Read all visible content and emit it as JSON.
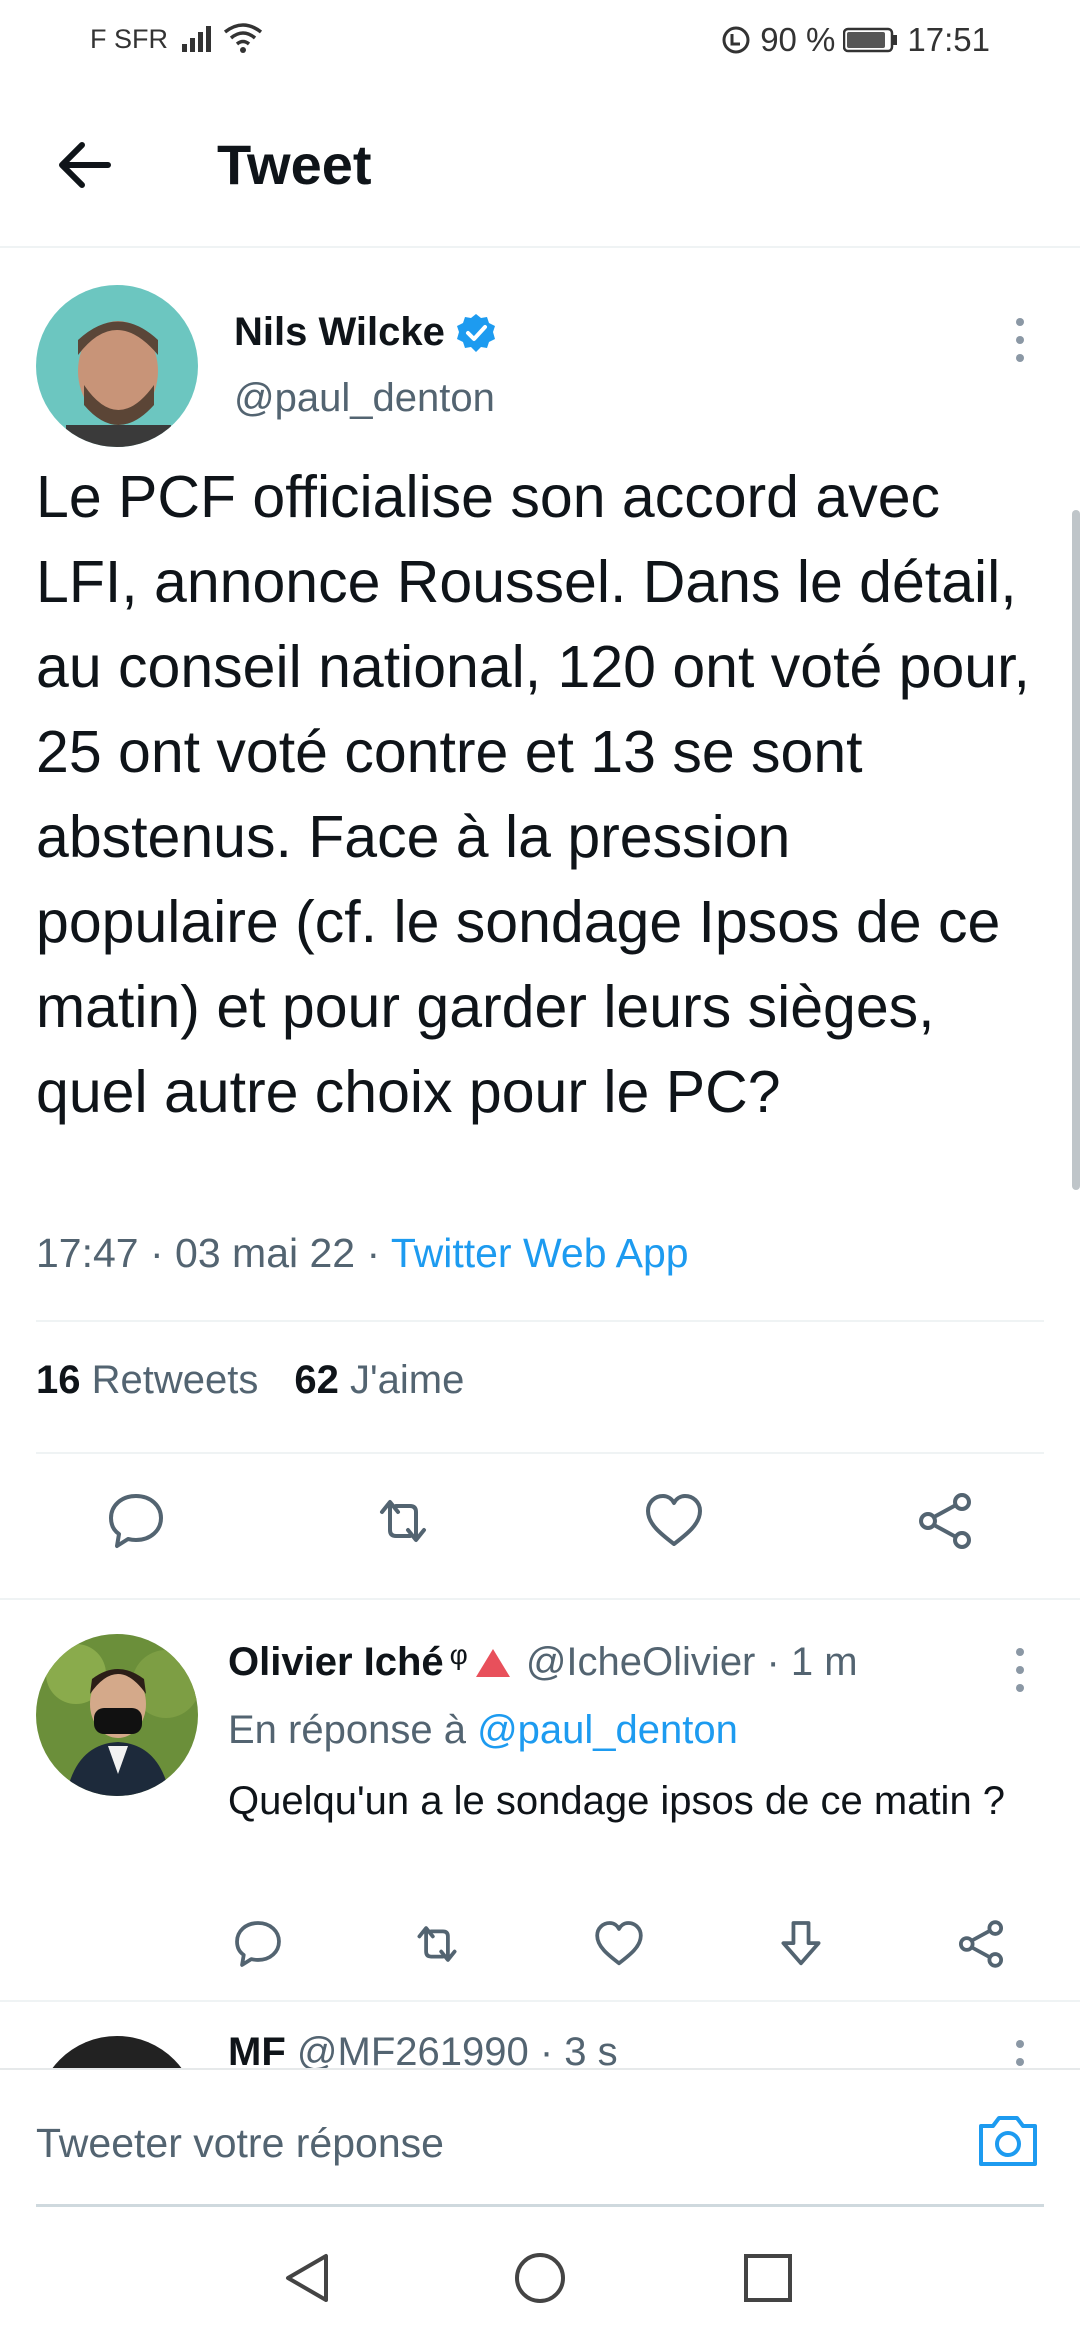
{
  "status_bar": {
    "carrier": "F SFR",
    "battery_text": "90 %",
    "time": "17:51"
  },
  "header": {
    "title": "Tweet"
  },
  "tweet": {
    "author_name": "Nils Wilcke",
    "author_handle": "@paul_denton",
    "text": "Le PCF officialise son accord avec LFI, annonce Roussel. Dans le détail, au conseil national, 120 ont voté pour, 25 ont voté contre et 13 se sont abstenus. Face à la pression populaire (cf. le sondage Ipsos de ce matin) et pour garder leurs sièges, quel autre choix pour le PC?",
    "time": "17:47",
    "date": "03 mai 22",
    "source": "Twitter Web App",
    "retweets_count": "16",
    "retweets_label": "Retweets",
    "likes_count": "62",
    "likes_label": "J'aime"
  },
  "reply": {
    "name": "Olivier Iché",
    "symbol": "φ",
    "handle_time": "@IcheOlivier · 1 m",
    "in_reply_prefix": "En réponse à",
    "in_reply_handle": "@paul_denton",
    "text": "Quelqu'un a le sondage ipsos de ce matin ?"
  },
  "reply2": {
    "name": "MF",
    "handle_time": "@MF261990 · 3 s"
  },
  "compose": {
    "placeholder": "Tweeter votre réponse"
  },
  "colors": {
    "accent": "#1d9bf0",
    "text_primary": "#0f1419",
    "text_secondary": "#536471"
  }
}
